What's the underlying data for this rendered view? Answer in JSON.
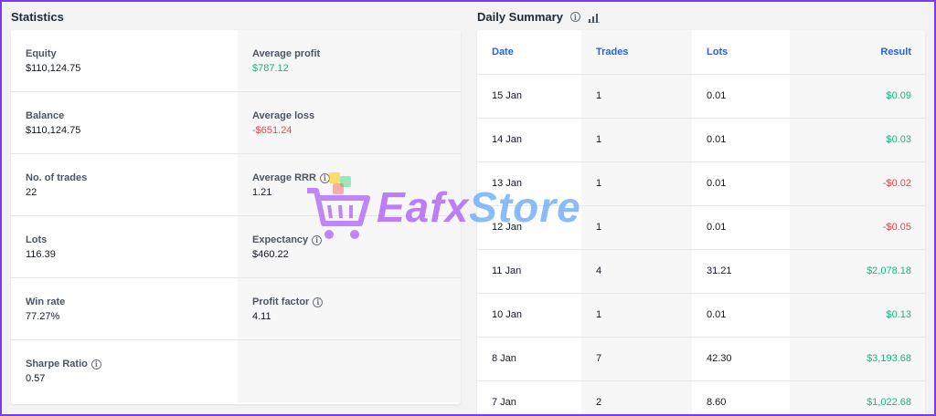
{
  "statistics": {
    "title": "Statistics",
    "left": [
      {
        "label": "Equity",
        "value": "$110,124.75",
        "tone": "normal",
        "info": false
      },
      {
        "label": "Balance",
        "value": "$110,124.75",
        "tone": "normal",
        "info": false
      },
      {
        "label": "No. of trades",
        "value": "22",
        "tone": "normal",
        "info": false
      },
      {
        "label": "Lots",
        "value": "116.39",
        "tone": "normal",
        "info": false
      },
      {
        "label": "Win rate",
        "value": "77.27%",
        "tone": "normal",
        "info": false
      },
      {
        "label": "Sharpe Ratio",
        "value": "0.57",
        "tone": "normal",
        "info": true
      }
    ],
    "right": [
      {
        "label": "Average profit",
        "value": "$787.12",
        "tone": "pos",
        "info": false
      },
      {
        "label": "Average loss",
        "value": "-$651.24",
        "tone": "neg",
        "info": false
      },
      {
        "label": "Average RRR",
        "value": "1.21",
        "tone": "normal",
        "info": true
      },
      {
        "label": "Expectancy",
        "value": "$460.22",
        "tone": "normal",
        "info": true
      },
      {
        "label": "Profit factor",
        "value": "4.11",
        "tone": "normal",
        "info": true
      }
    ]
  },
  "daily_summary": {
    "title": "Daily Summary",
    "columns": [
      "Date",
      "Trades",
      "Lots",
      "Result"
    ],
    "rows": [
      {
        "date": "15 Jan",
        "trades": "1",
        "lots": "0.01",
        "result": "$0.09",
        "tone": "pos"
      },
      {
        "date": "14 Jan",
        "trades": "1",
        "lots": "0.01",
        "result": "$0.03",
        "tone": "pos"
      },
      {
        "date": "13 Jan",
        "trades": "1",
        "lots": "0.01",
        "result": "-$0.02",
        "tone": "neg"
      },
      {
        "date": "12 Jan",
        "trades": "1",
        "lots": "0.01",
        "result": "-$0.05",
        "tone": "neg"
      },
      {
        "date": "11 Jan",
        "trades": "4",
        "lots": "31.21",
        "result": "$2,078.18",
        "tone": "pos"
      },
      {
        "date": "10 Jan",
        "trades": "1",
        "lots": "0.01",
        "result": "$0.13",
        "tone": "pos"
      },
      {
        "date": "8 Jan",
        "trades": "7",
        "lots": "42.30",
        "result": "$3,193.68",
        "tone": "pos"
      },
      {
        "date": "7 Jan",
        "trades": "2",
        "lots": "8.60",
        "result": "$1,022.68",
        "tone": "pos"
      }
    ]
  },
  "watermark": {
    "part1": "Eafx",
    "part2": "Store"
  },
  "colors": {
    "accent": "#2563eb",
    "positive": "#10b981",
    "negative": "#ef4444",
    "border": "#7c3aed"
  },
  "icons": {
    "info": "info-icon",
    "chart": "bar-chart-icon",
    "cart": "shopping-cart-icon"
  }
}
